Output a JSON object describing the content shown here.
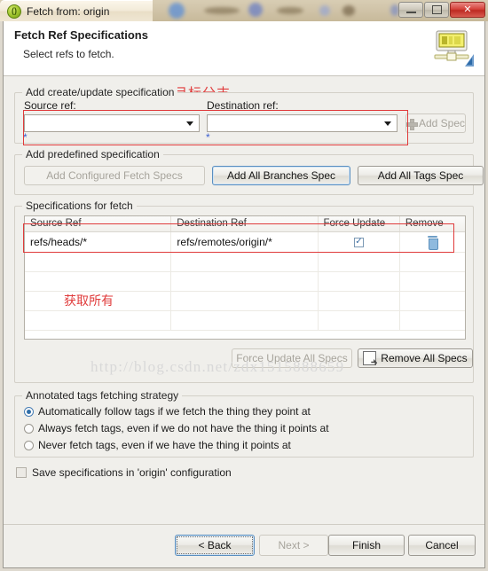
{
  "window": {
    "title": "Fetch from: origin",
    "app_icon": "git-icon",
    "controls": {
      "minimize": "minimize-icon",
      "restore": "restore-icon",
      "close": "close-icon"
    }
  },
  "banner": {
    "title": "Fetch Ref Specifications",
    "subtitle": "Select refs to fetch.",
    "icon": "remote-server-icon"
  },
  "annotations": {
    "top": "本地源分支和服务器目标分支",
    "table": "获取所有",
    "color": "#e03b3b"
  },
  "watermark": "http://blog.csdn.net/zdx1515888659",
  "create_update": {
    "legend": "Add create/update specification",
    "source_label": "Source ref:",
    "source_value": "",
    "destination_label": "Destination ref:",
    "destination_value": "",
    "required_marker": "*",
    "add_spec_label": "Add Spec",
    "add_spec_icon": "plus-icon"
  },
  "predefined": {
    "legend": "Add predefined specification",
    "buttons": [
      {
        "label": "Add Configured Fetch Specs",
        "enabled": false
      },
      {
        "label": "Add All Branches Spec",
        "enabled": true
      },
      {
        "label": "Add All Tags Spec",
        "enabled": true
      }
    ]
  },
  "specs": {
    "legend": "Specifications for fetch",
    "columns": [
      "Source Ref",
      "Destination Ref",
      "Force Update",
      "Remove"
    ],
    "rows": [
      {
        "source": "refs/heads/*",
        "destination": "refs/remotes/origin/*",
        "force_update": true,
        "remove_icon": "trash-icon"
      }
    ],
    "empty_rows": 4,
    "force_update_all_label": "Force Update All Specs",
    "force_update_all_enabled": false,
    "remove_all_label": "Remove All Specs",
    "remove_all_icon": "remove-page-icon",
    "remove_all_enabled": true
  },
  "tags_strategy": {
    "legend": "Annotated tags fetching strategy",
    "options": [
      {
        "label": "Automatically follow tags if we fetch the thing they point at",
        "selected": true
      },
      {
        "label": "Always fetch tags, even if we do not have the thing it points at",
        "selected": false
      },
      {
        "label": "Never fetch tags, even if we have the thing it points at",
        "selected": false
      }
    ]
  },
  "save_config": {
    "label": "Save specifications in 'origin' configuration",
    "checked": false
  },
  "footer": {
    "buttons": [
      {
        "label": "< Back",
        "enabled": true,
        "focused": true
      },
      {
        "label": "Next >",
        "enabled": false,
        "focused": false
      },
      {
        "label": "Finish",
        "enabled": true,
        "focused": false
      },
      {
        "label": "Cancel",
        "enabled": true,
        "focused": false
      }
    ]
  }
}
